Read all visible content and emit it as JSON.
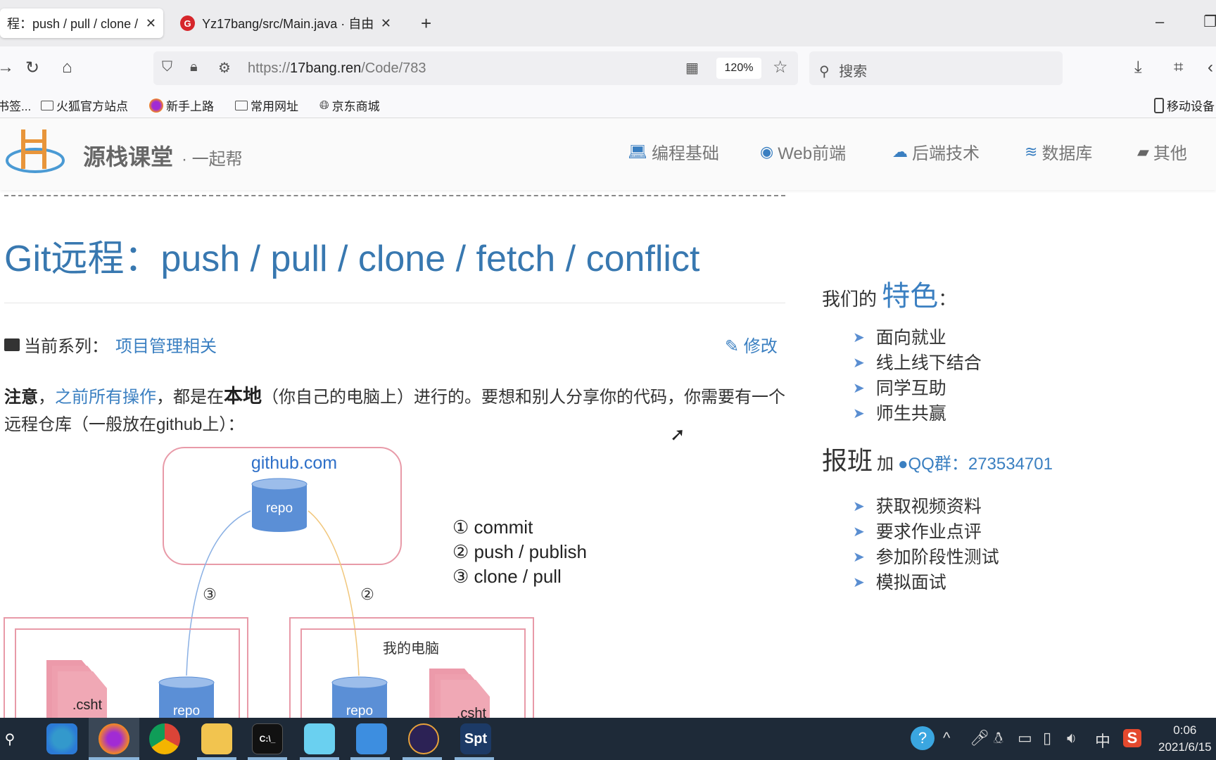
{
  "browser": {
    "tabs": [
      {
        "label": "程：push / pull / clone /",
        "active": true
      },
      {
        "label": "Yz17bang/src/Main.java · 自由",
        "icon": "gitee-icon",
        "active": false
      }
    ],
    "new_tab": "+",
    "url_prefix": "https://",
    "url_domain": "17bang.ren",
    "url_path": "/Code/783",
    "zoom_level": "120%",
    "search_placeholder": "搜索",
    "bookmarks": [
      {
        "label": "书签...",
        "icon": "bookmark-icon"
      },
      {
        "label": "火狐官方站点",
        "icon": "folder-icon"
      },
      {
        "label": "新手上路",
        "icon": "firefox-icon"
      },
      {
        "label": "常用网址",
        "icon": "folder-icon"
      },
      {
        "label": "京东商城",
        "icon": "globe-icon"
      }
    ],
    "mobile_bookmarks": "移动设备"
  },
  "site": {
    "brand": "源栈课堂",
    "slogan": "· 一起帮",
    "nav": [
      {
        "label": "编程基础",
        "icon": "laptop-icon"
      },
      {
        "label": "Web前端",
        "icon": "chrome-icon"
      },
      {
        "label": "后端技术",
        "icon": "cloud-icon"
      },
      {
        "label": "数据库",
        "icon": "database-icon"
      },
      {
        "label": "其他",
        "icon": "book-icon"
      }
    ]
  },
  "article": {
    "title": "Git远程：push / pull / clone / fetch / conflict",
    "series_label": "当前系列：",
    "series_link": "项目管理相关",
    "edit_label": "修改",
    "para_bold1": "注意",
    "para_sep1": "，",
    "para_link": "之前所有操作",
    "para_text1": "，都是在",
    "para_bold2": "本地",
    "para_text2": "（你自己的电脑上）进行的。要想和别人分享你的代码，你需要有一个远程仓库（一般放在github上）："
  },
  "diagram": {
    "remote_label": "github.com",
    "repo_label": "repo",
    "legend": [
      "① commit",
      "② push / publish",
      "③ clone / pull"
    ],
    "arrow_3": "③",
    "arrow_2": "②",
    "my_computer": "我的电脑",
    "file_label": ".csht"
  },
  "aside": {
    "features_prefix": "我们的",
    "features_big": "特色",
    "features_suffix": "：",
    "features": [
      "面向就业",
      "线上线下结合",
      "同学互助",
      "师生共赢"
    ],
    "signup_big": "报班",
    "signup_add": "加",
    "qq_group": "QQ群：273534701",
    "benefits": [
      "获取视频资料",
      "要求作业点评",
      "参加阶段性测试",
      "模拟面试"
    ]
  },
  "taskbar": {
    "apps": [
      "search",
      "edge",
      "firefox",
      "chrome",
      "explorer",
      "terminal",
      "app",
      "control-panel",
      "eclipse",
      "Spt"
    ],
    "ime": "中",
    "time": "0:06",
    "date": "2021/6/15"
  }
}
